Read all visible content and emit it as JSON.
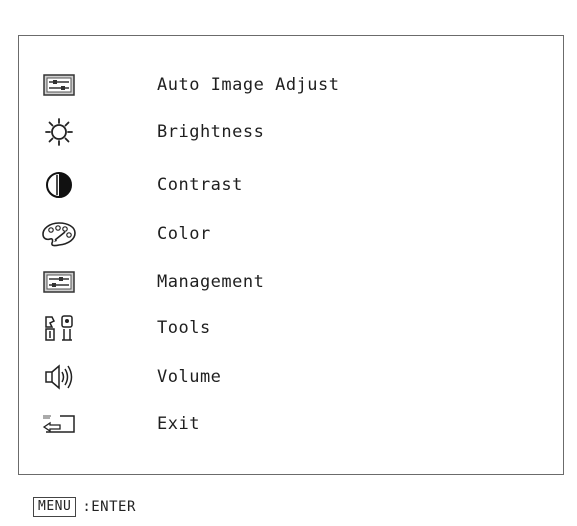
{
  "menu": {
    "items": [
      {
        "label": "Auto Image Adjust",
        "icon": "auto-adjust-icon"
      },
      {
        "label": "Brightness",
        "icon": "brightness-icon"
      },
      {
        "label": "Contrast",
        "icon": "contrast-icon"
      },
      {
        "label": "Color",
        "icon": "color-palette-icon"
      },
      {
        "label": "Management",
        "icon": "management-icon"
      },
      {
        "label": "Tools",
        "icon": "tools-icon"
      },
      {
        "label": "Volume",
        "icon": "volume-icon"
      },
      {
        "label": "Exit",
        "icon": "exit-icon"
      }
    ]
  },
  "footer": {
    "key_label": "MENU",
    "action_text": ":ENTER"
  }
}
